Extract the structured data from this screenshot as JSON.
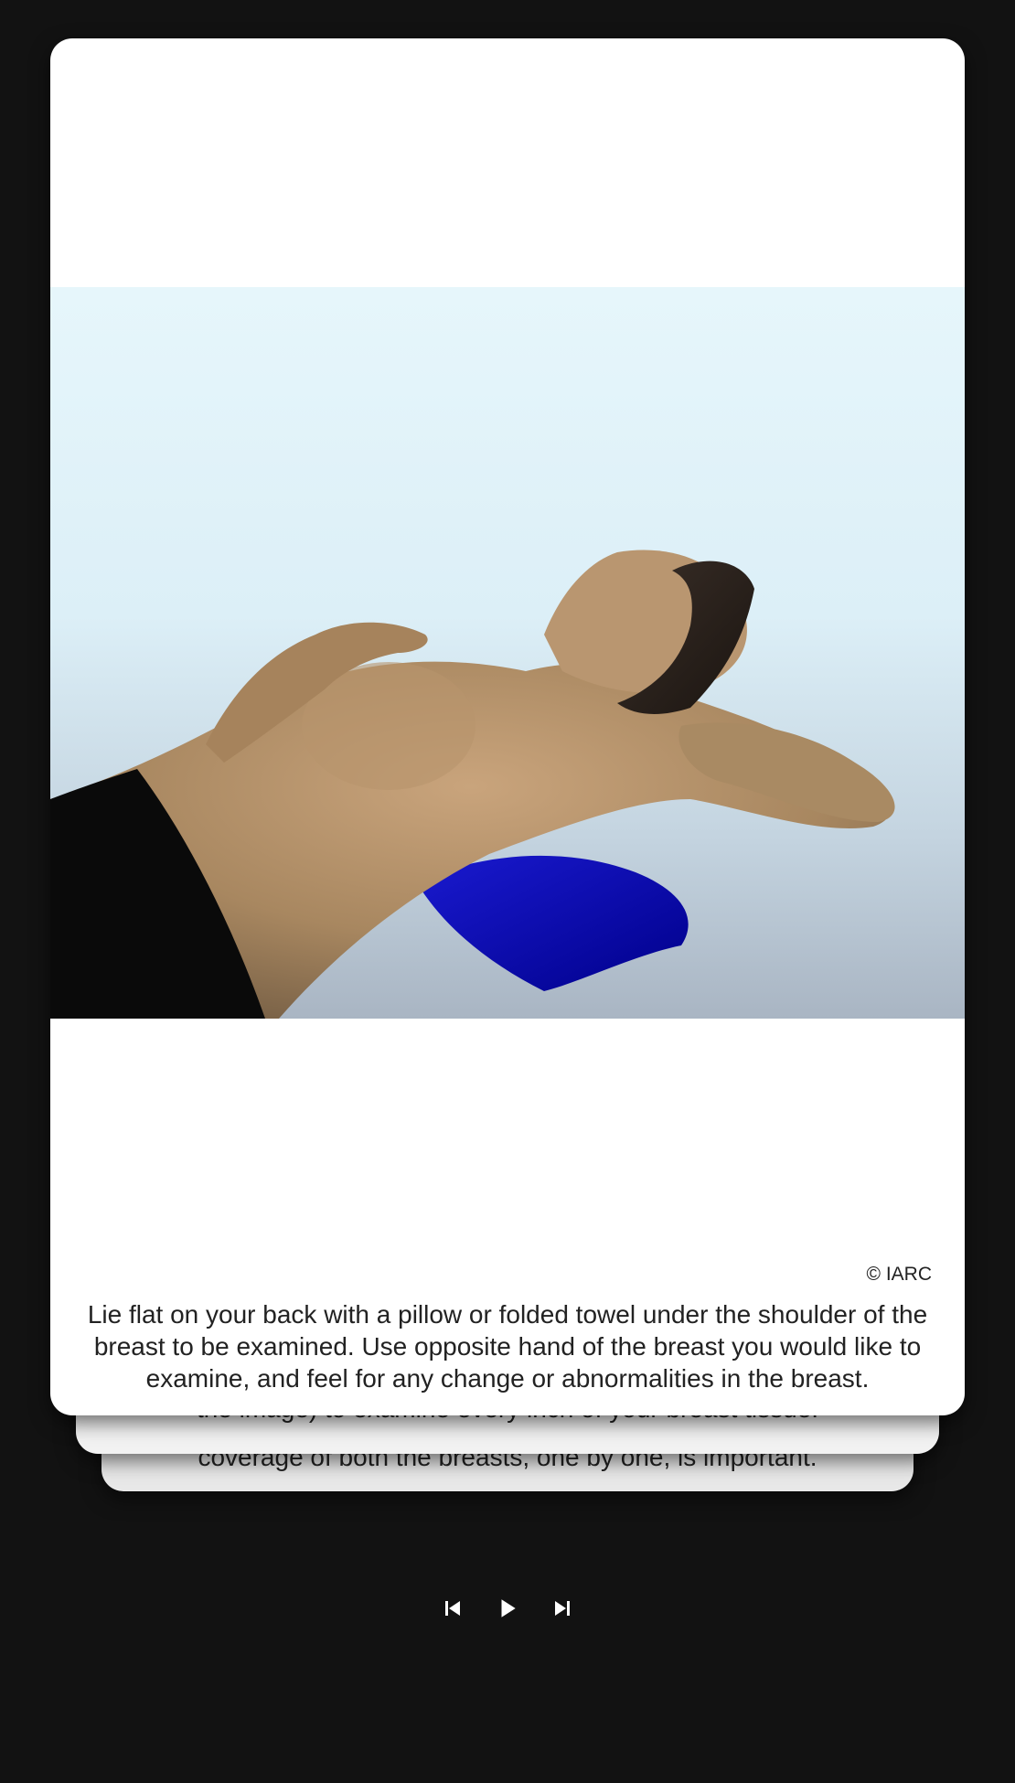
{
  "slides": {
    "current": {
      "copyright": "© IARC",
      "caption": "Lie flat on your back with a pillow or folded towel under the shoulder of the breast to be examined. Use opposite hand of the breast you would like to examine, and feel for any change or abnormalities in the breast."
    },
    "next_1": {
      "caption_partial": "the image) to examine every inch of your breast tissue."
    },
    "next_2": {
      "caption_partial": "coverage of both the breasts, one by one, is important."
    }
  },
  "controls": {
    "previous_icon": "skip-previous-icon",
    "play_icon": "play-icon",
    "next_icon": "skip-next-icon"
  },
  "colors": {
    "background": "#121212",
    "card": "#ffffff",
    "text": "#222222",
    "icon": "#ffffff"
  }
}
